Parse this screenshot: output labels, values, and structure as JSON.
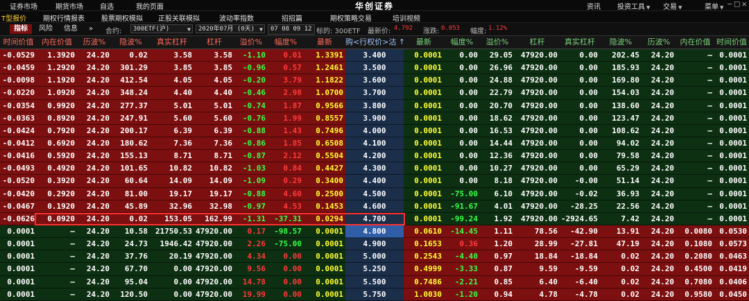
{
  "top_menu": {
    "left_items": [
      "证券市场",
      "期货市场",
      "自选",
      "我的页面"
    ],
    "brand": "华创证券",
    "right_items": [
      {
        "label": "资讯",
        "has_dropdown": false
      },
      {
        "label": "投资工具",
        "has_dropdown": true
      },
      {
        "label": "交易",
        "has_dropdown": true
      },
      {
        "label": "菜单",
        "has_dropdown": true
      }
    ],
    "window_controls": [
      "−",
      "□",
      "×"
    ]
  },
  "sub_menu": {
    "items": [
      "T型报价",
      "期权行情报表",
      "股票期权模拟",
      "正股关联模拟",
      "波动率指数",
      "招招篇",
      "期权策略交易",
      "培训视频"
    ],
    "active": "T型报价"
  },
  "controls": {
    "tabs": [
      "指标",
      "风险",
      "信息"
    ],
    "active_tab": "指标",
    "collapse_icon": "»",
    "contract_label": "合约:",
    "contract_value": "300ETF(沪)",
    "expiry_value": "2020年07月 (0天)",
    "time_value": "07 08 09 12",
    "underlying": "标的: 300ETF",
    "last_price_label": "最新价:",
    "last_price": "4.792",
    "change_label": "涨跌:",
    "change": "0.053",
    "change_pct_label": "幅度:",
    "change_pct": "1.12%"
  },
  "colors": {
    "call_itm": "#7c0f0f",
    "call_otm": "#0d2f12",
    "put_itm": "#0d2f12",
    "put_otm": "#7c0f0f",
    "strike_col": "#1b2e4a",
    "strike_col_selected": "#2f5ea6",
    "highlight_border": "#ff3030",
    "text_white": "#ffffff",
    "text_red": "#ff3b3b",
    "text_green": "#3aff4a",
    "text_yellow": "#ffff33"
  },
  "table": {
    "call_headers": [
      "时间价值",
      "内在价值",
      "历波%",
      "隐波%",
      "真实杠杆",
      "杠杆",
      "溢价%",
      "幅度%",
      "最新"
    ],
    "strike_header": "购<行权价>沽 ↑",
    "put_headers": [
      "最新",
      "幅度%",
      "溢价%",
      "杠杆",
      "真实杠杆",
      "隐波%",
      "历波%",
      "内在价值",
      "时间价值"
    ],
    "highlighted_strike": "4.700",
    "selected_strike": "4.800",
    "rows": [
      {
        "strike": "3.400",
        "call_itm": true,
        "call": [
          "-0.0529",
          "1.3920",
          "24.20",
          "0.02",
          "3.58",
          "3.58",
          "-1.10",
          "0.01",
          "1.3391"
        ],
        "put": [
          "0.0001",
          "0.00",
          "29.05",
          "47920.00",
          "0.00",
          "202.45",
          "24.20",
          "—",
          "0.0001"
        ]
      },
      {
        "strike": "3.500",
        "call_itm": true,
        "call": [
          "-0.0459",
          "1.2920",
          "24.20",
          "301.29",
          "3.85",
          "3.85",
          "-0.96",
          "0.57",
          "1.2461"
        ],
        "put": [
          "0.0001",
          "0.00",
          "26.96",
          "47920.00",
          "0.00",
          "185.93",
          "24.20",
          "—",
          "0.0001"
        ]
      },
      {
        "strike": "3.600",
        "call_itm": true,
        "call": [
          "-0.0098",
          "1.1920",
          "24.20",
          "412.54",
          "4.05",
          "4.05",
          "-0.20",
          "3.79",
          "1.1822"
        ],
        "put": [
          "0.0001",
          "0.00",
          "24.88",
          "47920.00",
          "0.00",
          "169.80",
          "24.20",
          "—",
          "0.0001"
        ]
      },
      {
        "strike": "3.700",
        "call_itm": true,
        "call": [
          "-0.0220",
          "1.0920",
          "24.20",
          "348.24",
          "4.40",
          "4.40",
          "-0.46",
          "2.98",
          "1.0700"
        ],
        "put": [
          "0.0001",
          "0.00",
          "22.79",
          "47920.00",
          "0.00",
          "154.03",
          "24.20",
          "—",
          "0.0001"
        ]
      },
      {
        "strike": "3.800",
        "call_itm": true,
        "call": [
          "-0.0354",
          "0.9920",
          "24.20",
          "277.37",
          "5.01",
          "5.01",
          "-0.74",
          "1.87",
          "0.9566"
        ],
        "put": [
          "0.0001",
          "0.00",
          "20.70",
          "47920.00",
          "0.00",
          "138.60",
          "24.20",
          "—",
          "0.0001"
        ]
      },
      {
        "strike": "3.900",
        "call_itm": true,
        "call": [
          "-0.0363",
          "0.8920",
          "24.20",
          "247.91",
          "5.60",
          "5.60",
          "-0.76",
          "1.99",
          "0.8557"
        ],
        "put": [
          "0.0001",
          "0.00",
          "18.62",
          "47920.00",
          "0.00",
          "123.47",
          "24.20",
          "—",
          "0.0001"
        ]
      },
      {
        "strike": "4.000",
        "call_itm": true,
        "call": [
          "-0.0424",
          "0.7920",
          "24.20",
          "200.17",
          "6.39",
          "6.39",
          "-0.88",
          "1.43",
          "0.7496"
        ],
        "put": [
          "0.0001",
          "0.00",
          "16.53",
          "47920.00",
          "0.00",
          "108.62",
          "24.20",
          "—",
          "0.0001"
        ]
      },
      {
        "strike": "4.100",
        "call_itm": true,
        "call": [
          "-0.0412",
          "0.6920",
          "24.20",
          "180.62",
          "7.36",
          "7.36",
          "-0.86",
          "1.85",
          "0.6508"
        ],
        "put": [
          "0.0001",
          "0.00",
          "14.44",
          "47920.00",
          "0.00",
          "94.02",
          "24.20",
          "—",
          "0.0001"
        ]
      },
      {
        "strike": "4.200",
        "call_itm": true,
        "call": [
          "-0.0416",
          "0.5920",
          "24.20",
          "155.13",
          "8.71",
          "8.71",
          "-0.87",
          "2.12",
          "0.5504"
        ],
        "put": [
          "0.0001",
          "0.00",
          "12.36",
          "47920.00",
          "0.00",
          "79.58",
          "24.20",
          "—",
          "0.0001"
        ]
      },
      {
        "strike": "4.300",
        "call_itm": true,
        "call": [
          "-0.0493",
          "0.4920",
          "24.20",
          "101.65",
          "10.82",
          "10.82",
          "-1.03",
          "0.84",
          "0.4427"
        ],
        "put": [
          "0.0001",
          "0.00",
          "10.27",
          "47920.00",
          "0.00",
          "65.29",
          "24.20",
          "—",
          "0.0001"
        ]
      },
      {
        "strike": "4.400",
        "call_itm": true,
        "call": [
          "-0.0520",
          "0.3920",
          "24.20",
          "60.64",
          "14.09",
          "14.09",
          "-1.09",
          "0.29",
          "0.3400"
        ],
        "put": [
          "0.0001",
          "0.00",
          "8.18",
          "47920.00",
          "-0.00",
          "51.14",
          "24.20",
          "—",
          "0.0001"
        ]
      },
      {
        "strike": "4.500",
        "call_itm": true,
        "call": [
          "-0.0420",
          "0.2920",
          "24.20",
          "81.00",
          "19.17",
          "19.17",
          "-0.88",
          "4.60",
          "0.2500"
        ],
        "put": [
          "0.0001",
          "-75.00",
          "6.10",
          "47920.00",
          "-0.02",
          "36.93",
          "24.20",
          "—",
          "0.0001"
        ]
      },
      {
        "strike": "4.600",
        "call_itm": true,
        "call": [
          "-0.0467",
          "0.1920",
          "24.20",
          "45.89",
          "32.96",
          "32.98",
          "-0.97",
          "4.53",
          "0.1453"
        ],
        "put": [
          "0.0001",
          "-91.67",
          "4.01",
          "47920.00",
          "-28.25",
          "22.56",
          "24.20",
          "—",
          "0.0001"
        ]
      },
      {
        "strike": "4.700",
        "call_itm": true,
        "call": [
          "-0.0626",
          "0.0920",
          "24.20",
          "0.02",
          "153.05",
          "162.99",
          "-1.31",
          "-37.31",
          "0.0294"
        ],
        "put": [
          "0.0001",
          "-99.24",
          "1.92",
          "47920.00",
          "-2924.65",
          "7.42",
          "24.20",
          "—",
          "0.0001"
        ]
      },
      {
        "strike": "4.800",
        "call_itm": false,
        "call": [
          "0.0001",
          "—",
          "24.20",
          "10.58",
          "21750.53",
          "47920.00",
          "0.17",
          "-98.57",
          "0.0001"
        ],
        "put": [
          "0.0610",
          "-14.45",
          "1.11",
          "78.56",
          "-42.90",
          "13.91",
          "24.20",
          "0.0080",
          "0.0530"
        ]
      },
      {
        "strike": "4.900",
        "call_itm": false,
        "call": [
          "0.0001",
          "—",
          "24.20",
          "24.73",
          "1946.42",
          "47920.00",
          "2.26",
          "-75.00",
          "0.0001"
        ],
        "put": [
          "0.1653",
          "0.36",
          "1.20",
          "28.99",
          "-27.81",
          "47.19",
          "24.20",
          "0.1080",
          "0.0573"
        ]
      },
      {
        "strike": "5.000",
        "call_itm": false,
        "call": [
          "0.0001",
          "—",
          "24.20",
          "37.76",
          "20.19",
          "47920.00",
          "4.34",
          "0.00",
          "0.0001"
        ],
        "put": [
          "0.2543",
          "-4.40",
          "0.97",
          "18.84",
          "-18.84",
          "0.02",
          "24.20",
          "0.2080",
          "0.0463"
        ]
      },
      {
        "strike": "5.250",
        "call_itm": false,
        "call": [
          "0.0001",
          "—",
          "24.20",
          "67.70",
          "0.00",
          "47920.00",
          "9.56",
          "0.00",
          "0.0001"
        ],
        "put": [
          "0.4999",
          "-3.33",
          "0.87",
          "9.59",
          "-9.59",
          "0.02",
          "24.20",
          "0.4500",
          "0.0419"
        ]
      },
      {
        "strike": "5.500",
        "call_itm": false,
        "call": [
          "0.0001",
          "—",
          "24.20",
          "95.04",
          "0.00",
          "47920.00",
          "14.78",
          "0.00",
          "0.0001"
        ],
        "put": [
          "0.7486",
          "-2.21",
          "0.85",
          "6.40",
          "-6.40",
          "0.02",
          "24.20",
          "0.7080",
          "0.0406"
        ]
      },
      {
        "strike": "5.750",
        "call_itm": false,
        "call": [
          "0.0001",
          "—",
          "24.20",
          "120.50",
          "0.00",
          "47920.00",
          "19.99",
          "0.00",
          "0.0001"
        ],
        "put": [
          "1.0030",
          "-1.20",
          "0.94",
          "4.78",
          "-4.78",
          "0.02",
          "24.20",
          "0.9580",
          "0.0450"
        ]
      }
    ]
  }
}
